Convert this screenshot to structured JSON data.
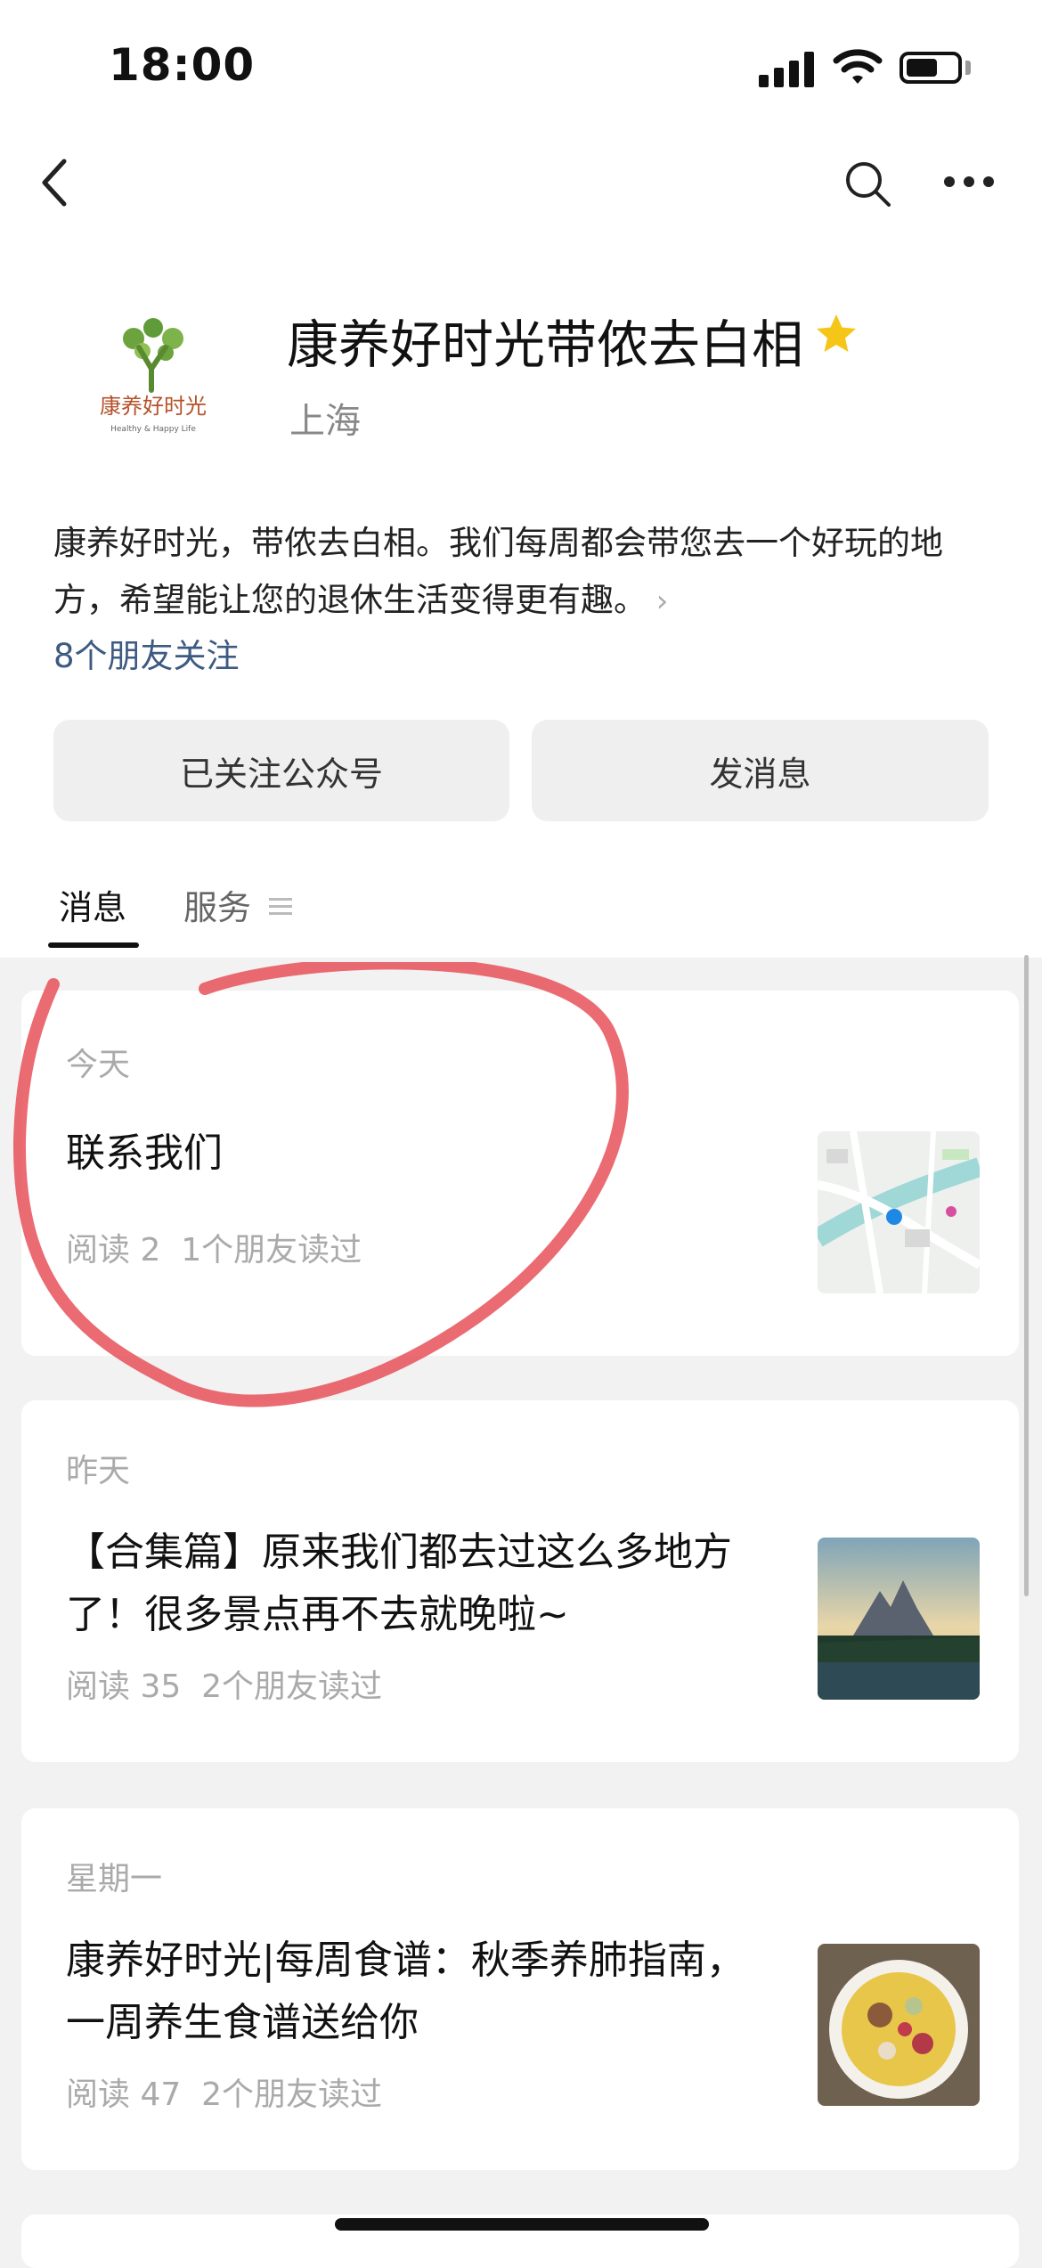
{
  "status_bar": {
    "time": "18:00"
  },
  "account": {
    "name": "康养好时光带侬去白相",
    "location": "上海",
    "description": "康养好时光，带侬去白相。我们每周都会带您去一个好玩的地方，希望能让您的退休生活变得更有趣。",
    "followers": "8个朋友关注",
    "logo_text": "康养好时光",
    "logo_subtext": "Healthy & Happy Life"
  },
  "buttons": {
    "follow": "已关注公众号",
    "message": "发消息"
  },
  "tabs": [
    {
      "label": "消息",
      "active": true
    },
    {
      "label": "服务",
      "active": false
    }
  ],
  "articles": [
    {
      "date": "今天",
      "title": "联系我们",
      "reads": "阅读 2",
      "friends": "1个朋友读过",
      "thumb": "map-thumbnail"
    },
    {
      "date": "昨天",
      "title": "【合集篇】原来我们都去过这么多地方了！很多景点再不去就晚啦~",
      "reads": "阅读 35",
      "friends": "2个朋友读过",
      "thumb": "mountain-lake-thumbnail"
    },
    {
      "date": "星期一",
      "title": "康养好时光|每周食谱：秋季养肺指南，一周养生食谱送给你",
      "reads": "阅读 47",
      "friends": "2个朋友读过",
      "thumb": "soup-bowl-thumbnail"
    }
  ],
  "colors": {
    "star": "#f5c518",
    "link": "#3d5a80",
    "annotation": "#e8515a"
  }
}
